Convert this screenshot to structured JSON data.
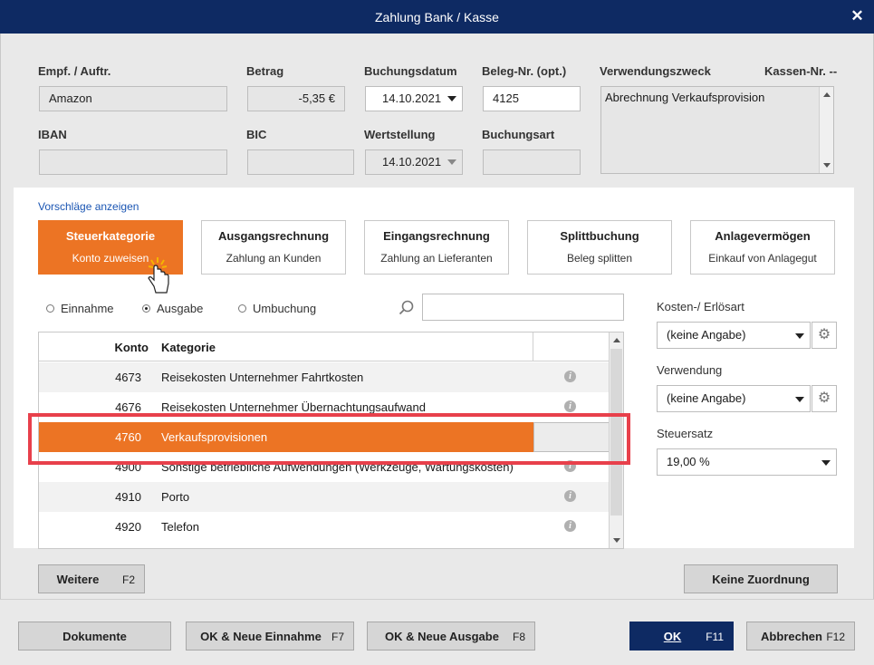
{
  "window": {
    "title": "Zahlung Bank / Kasse",
    "close_label": "✕"
  },
  "form": {
    "payee_label": "Empf. / Auftr.",
    "payee_value": "Amazon",
    "amount_label": "Betrag",
    "amount_value": "-5,35 €",
    "booking_date_label": "Buchungsdatum",
    "booking_date_value": "14.10.2021",
    "receipt_label": "Beleg-Nr. (opt.)",
    "receipt_value": "4125",
    "purpose_label": "Verwendungszweck",
    "purpose_value": "Abrechnung Verkaufsprovision",
    "cash_label": "Kassen-Nr. --",
    "iban_label": "IBAN",
    "iban_value": "",
    "bic_label": "BIC",
    "bic_value": "",
    "value_date_label": "Wertstellung",
    "value_date_value": "14.10.2021",
    "booking_type_label": "Buchungsart",
    "booking_type_value": ""
  },
  "suggestions_link": "Vorschläge anzeigen",
  "categories": [
    {
      "title": "Steuerkategorie",
      "sub": "Konto zuweisen",
      "active": true
    },
    {
      "title": "Ausgangsrechnung",
      "sub": "Zahlung an Kunden"
    },
    {
      "title": "Eingangsrechnung",
      "sub": "Zahlung an Lieferanten"
    },
    {
      "title": "Splittbuchung",
      "sub": "Beleg splitten"
    },
    {
      "title": "Anlagevermögen",
      "sub": "Einkauf von Anlagegut"
    }
  ],
  "radios": [
    {
      "label": "Einnahme",
      "checked": false
    },
    {
      "label": "Ausgabe",
      "checked": true
    },
    {
      "label": "Umbuchung",
      "checked": false
    }
  ],
  "search": {
    "placeholder": ""
  },
  "table": {
    "col_account": "Konto",
    "col_category": "Kategorie",
    "rows": [
      {
        "account": "4673",
        "category": "Reisekosten Unternehmer Fahrtkosten"
      },
      {
        "account": "4676",
        "category": "Reisekosten Unternehmer Übernachtungsaufwand"
      },
      {
        "account": "4760",
        "category": "Verkaufsprovisionen",
        "selected": true
      },
      {
        "account": "4900",
        "category": "Sonstige betriebliche Aufwendungen (Werkzeuge, Wartungskosten)"
      },
      {
        "account": "4910",
        "category": "Porto"
      },
      {
        "account": "4920",
        "category": "Telefon"
      }
    ]
  },
  "right": {
    "cost_label": "Kosten-/ Erlösart",
    "cost_value": "(keine Angabe)",
    "usage_label": "Verwendung",
    "usage_value": "(keine Angabe)",
    "tax_label": "Steuersatz",
    "tax_value": "19,00 %"
  },
  "buttons": {
    "more": "Weitere",
    "more_key": "F2",
    "no_assign": "Keine Zuordnung",
    "documents": "Dokumente",
    "ok_new_income": "OK & Neue Einnahme",
    "ok_new_income_key": "F7",
    "ok_new_expense": "OK & Neue Ausgabe",
    "ok_new_expense_key": "F8",
    "ok": "OK",
    "ok_key": "F11",
    "cancel": "Abbrechen",
    "cancel_key": "F12"
  },
  "colors": {
    "accent": "#ec7424",
    "title_bar": "#0e2a63",
    "highlight": "#e8404b",
    "link": "#1a55b3"
  },
  "icons": {
    "search": "search-icon",
    "gear": "gear-icon",
    "info": "info-icon",
    "cursor": "hand-cursor-icon"
  }
}
